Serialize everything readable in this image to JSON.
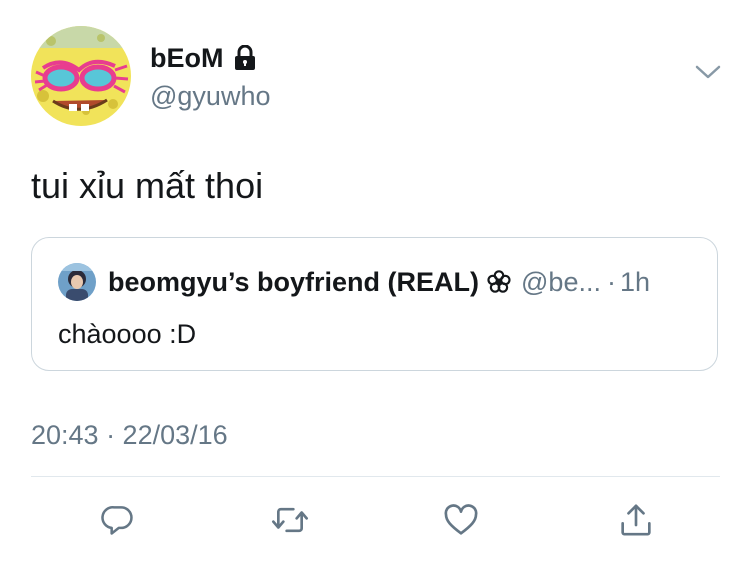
{
  "tweet": {
    "display_name": "bEoM",
    "handle": "@gyuwho",
    "text": "tui xỉu mất thoi",
    "timestamp": "20:43 · 22/03/16",
    "protected": true
  },
  "quoted_tweet": {
    "display_name": "beomgyu’s boyfriend (REAL)",
    "handle": "@be...",
    "separator": "·",
    "time": "1h",
    "text": "chàoooo :D"
  },
  "icons": {
    "lock": "lock-icon",
    "chevron": "chevron-down-icon",
    "flower": "flower-icon",
    "reply": "reply-icon",
    "retweet": "retweet-icon",
    "like": "heart-icon",
    "share": "share-icon"
  },
  "colors": {
    "text": "#14171a",
    "secondary": "#657786",
    "border": "#ccd6dd",
    "icon": "#657786"
  }
}
